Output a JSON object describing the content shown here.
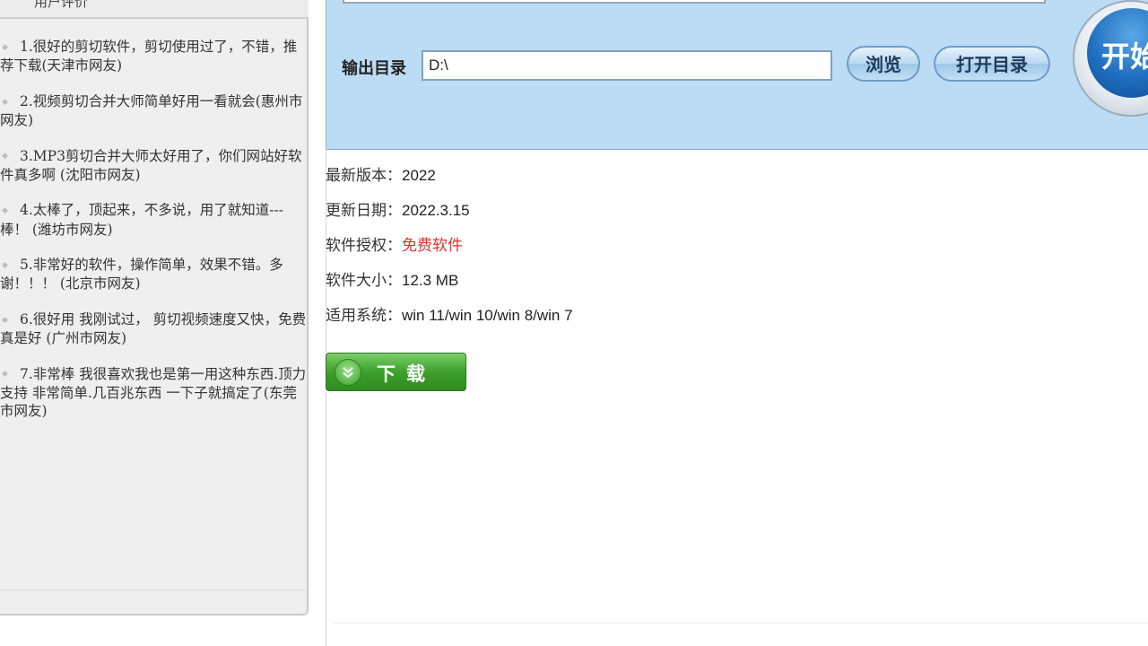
{
  "sidebar": {
    "title": "用户评价",
    "reviews": [
      "1.很好的剪切软件，剪切使用过了，不错，推荐下载(天津市网友)",
      "2.视频剪切合并大师简单好用一看就会(惠州市网友)",
      "3.MP3剪切合并大师太好用了，你们网站好软件真多啊 (沈阳市网友)",
      "4.太棒了，顶起来，不多说，用了就知道---棒！ (潍坊市网友)",
      "5.非常好的软件，操作简单，效果不错。多谢！！！ (北京市网友)",
      "6.很好用 我刚试过， 剪切视频速度又快，免费真是好 (广州市网友)",
      "7.非常棒 我很喜欢我也是第一用这种东西.顶力支持 非常简单.几百兆东西 一下子就搞定了(东莞市网友)"
    ]
  },
  "tool": {
    "output_label": "输出目录",
    "output_value": "D:\\",
    "browse_label": "浏览",
    "open_dir_label": "打开目录",
    "start_label": "开始"
  },
  "info": {
    "version_key": "最新版本：",
    "version_val": "2022",
    "date_key": "更新日期：",
    "date_val": "2022.3.15",
    "license_key": "软件授权：",
    "license_val": "免费软件",
    "size_key": "软件大小：",
    "size_val": "12.3 MB",
    "os_key": "适用系统：",
    "os_val": "win 11/win 10/win 8/win 7"
  },
  "download": {
    "label": "下载",
    "icon": "double-chevron-down-icon"
  },
  "colors": {
    "panel_bg": "#bcdcf6",
    "free_red": "#e0312e",
    "download_green": "#3d9f2c"
  }
}
